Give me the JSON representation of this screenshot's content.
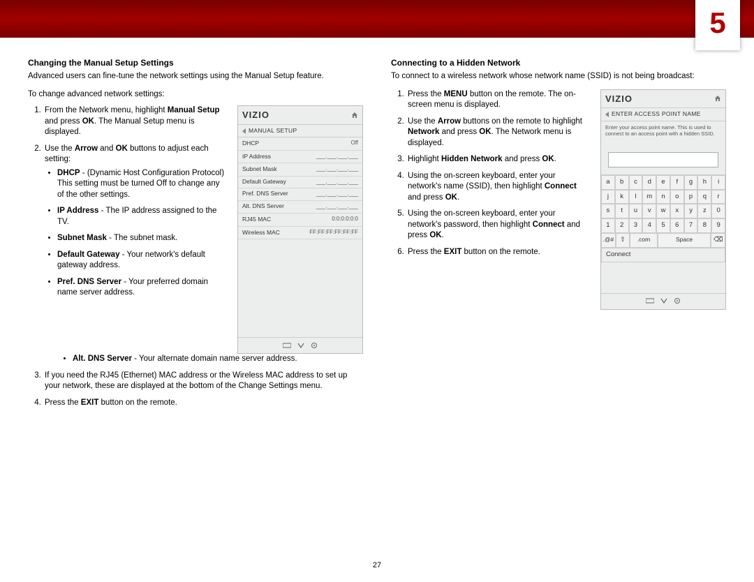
{
  "chapter_number": "5",
  "page_number": "27",
  "left": {
    "heading": "Changing the Manual Setup Settings",
    "intro": "Advanced users can fine-tune the network settings using the Manual Setup feature.",
    "lead": "To change advanced network settings:",
    "step1_a": "From the Network menu, highlight ",
    "step1_b": "Manual Setup",
    "step1_c": " and press ",
    "step1_d": "OK",
    "step1_e": ". The Manual Setup menu is displayed.",
    "step2_a": "Use the ",
    "step2_b": "Arrow",
    "step2_c": " and ",
    "step2_d": "OK",
    "step2_e": " buttons to adjust each setting:",
    "bul_dhcp_b": "DHCP",
    "bul_dhcp_t": " - (Dynamic Host Configuration Protocol) This setting must be turned Off to change any of the other settings.",
    "bul_ip_b": "IP Address",
    "bul_ip_t": " - The IP address assigned to the TV.",
    "bul_sm_b": "Subnet Mask",
    "bul_sm_t": " - The subnet mask.",
    "bul_dg_b": "Default Gateway",
    "bul_dg_t": " - Your network's default gateway address.",
    "bul_pd_b": "Pref. DNS Server",
    "bul_pd_t": " - Your preferred domain name server address.",
    "bul_ad_b": "Alt. DNS Server",
    "bul_ad_t": " - Your alternate domain name server address.",
    "step3": "If you need the RJ45 (Ethernet) MAC address or the Wireless MAC address to set up your network, these are displayed at the bottom of the Change Settings menu.",
    "step4_a": "Press the ",
    "step4_b": "EXIT",
    "step4_c": " button on the remote."
  },
  "right": {
    "heading": "Connecting to a Hidden Network",
    "intro": "To connect to a wireless network whose network name (SSID) is not being broadcast:",
    "s1_a": "Press the ",
    "s1_b": "MENU",
    "s1_c": " button on the remote. The on-screen menu is displayed.",
    "s2_a": "Use the ",
    "s2_b": "Arrow",
    "s2_c": " buttons on the remote to highlight ",
    "s2_d": "Network",
    "s2_e": " and press ",
    "s2_f": "OK",
    "s2_g": ". The Network menu is displayed.",
    "s3_a": "Highlight ",
    "s3_b": "Hidden Network",
    "s3_c": " and press ",
    "s3_d": "OK",
    "s3_e": ".",
    "s4_a": "Using the on-screen keyboard, enter your network's name (SSID), then highlight ",
    "s4_b": "Connect",
    "s4_c": " and press ",
    "s4_d": "OK",
    "s4_e": ".",
    "s5_a": "Using the on-screen keyboard, enter your network's password, then highlight ",
    "s5_b": "Connect",
    "s5_c": " and press ",
    "s5_d": "OK",
    "s5_e": ".",
    "s6_a": "Press the ",
    "s6_b": "EXIT",
    "s6_c": " button on the remote."
  },
  "panel1": {
    "logo": "VIZIO",
    "crumb": "MANUAL SETUP",
    "r1l": "DHCP",
    "r1v": "Off",
    "r2l": "IP Address",
    "r2v": "___.___.___.___",
    "r3l": "Subnet Mask",
    "r3v": "___.___.___.___",
    "r4l": "Default Gateway",
    "r4v": "___.___.___.___",
    "r5l": "Pref. DNS Server",
    "r5v": "___.___.___.___",
    "r6l": "Alt. DNS Server",
    "r6v": "___.___.___.___",
    "r7l": "RJ45 MAC",
    "r7v": "0:0:0:0:0:0",
    "r8l": "Wireless MAC",
    "r8v": "FF:FF:FF:FF:FF:FF"
  },
  "panel2": {
    "logo": "VIZIO",
    "crumb": "ENTER ACCESS POINT NAME",
    "help": "Enter your access point name. This is used to connect to an access point with a hidden SSID.",
    "kb_r1": [
      "a",
      "b",
      "c",
      "d",
      "e",
      "f",
      "g",
      "h",
      "i"
    ],
    "kb_r2": [
      "j",
      "k",
      "l",
      "m",
      "n",
      "o",
      "p",
      "q",
      "r"
    ],
    "kb_r3": [
      "s",
      "t",
      "u",
      "v",
      "w",
      "x",
      "y",
      "z",
      "0"
    ],
    "kb_r4": [
      "1",
      "2",
      "3",
      "4",
      "5",
      "6",
      "7",
      "8",
      "9"
    ],
    "kb_sym": ".@#",
    "kb_shift": "⇧",
    "kb_com": ".com",
    "kb_space": "Space",
    "kb_bksp": "⌫",
    "kb_connect": "Connect"
  }
}
